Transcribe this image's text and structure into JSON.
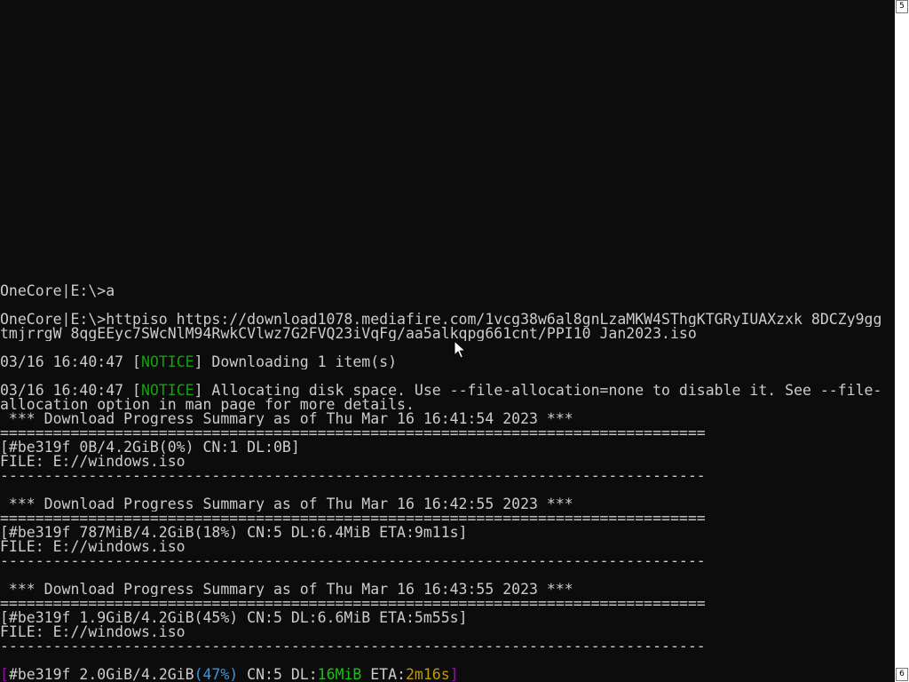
{
  "terminal": {
    "lines": [
      {
        "segments": [
          {
            "t": "OneCore|E:\\>a"
          }
        ]
      },
      {
        "segments": [
          {
            "t": "OneCore|E:\\>httpiso https://download1078.mediafire.com/1vcg38w6al8gnLzaMKW4SThgKTGRyIUAXzxk_8DCZy9gg"
          }
        ]
      },
      {
        "segments": [
          {
            "t": "tmjrrgW_8qgEEyc7SWcNlM94RwkCVlwz7G2FVQ23iVqFg/aa5alkqpg661cnt/PPI10_Jan2023.iso"
          }
        ]
      },
      {
        "segments": [
          {
            "t": "03/16 16:40:47 ["
          },
          {
            "t": "NOTICE",
            "c": "green"
          },
          {
            "t": "] Downloading 1 item(s)"
          }
        ]
      },
      {
        "segments": [
          {
            "t": "03/16 16:40:47 ["
          },
          {
            "t": "NOTICE",
            "c": "green"
          },
          {
            "t": "] Allocating disk space. Use --file-allocation=none to disable it. See --file-"
          }
        ]
      },
      {
        "segments": [
          {
            "t": "allocation option in man page for more details."
          }
        ]
      },
      {
        "segments": [
          {
            "t": " *** Download Progress Summary as of Thu Mar 16 16:41:54 2023 ***"
          }
        ]
      },
      {
        "segments": [
          {
            "t": "================================================================================"
          }
        ]
      },
      {
        "segments": [
          {
            "t": "[#be319f 0B/4.2GiB(0%) CN:1 DL:0B]"
          }
        ]
      },
      {
        "segments": [
          {
            "t": "FILE: E://windows.iso"
          }
        ]
      },
      {
        "segments": [
          {
            "t": "--------------------------------------------------------------------------------"
          }
        ]
      },
      {
        "segments": [
          {
            "t": " *** Download Progress Summary as of Thu Mar 16 16:42:55 2023 ***"
          }
        ]
      },
      {
        "segments": [
          {
            "t": "================================================================================"
          }
        ]
      },
      {
        "segments": [
          {
            "t": "[#be319f 787MiB/4.2GiB(18%) CN:5 DL:6.4MiB ETA:9m11s]"
          }
        ]
      },
      {
        "segments": [
          {
            "t": "FILE: E://windows.iso"
          }
        ]
      },
      {
        "segments": [
          {
            "t": "--------------------------------------------------------------------------------"
          }
        ]
      },
      {
        "segments": [
          {
            "t": " *** Download Progress Summary as of Thu Mar 16 16:43:55 2023 ***"
          }
        ]
      },
      {
        "segments": [
          {
            "t": "================================================================================"
          }
        ]
      },
      {
        "segments": [
          {
            "t": "[#be319f 1.9GiB/4.2GiB(45%) CN:5 DL:6.6MiB ETA:5m55s]"
          }
        ]
      },
      {
        "segments": [
          {
            "t": "FILE: E://windows.iso"
          }
        ]
      },
      {
        "segments": [
          {
            "t": "--------------------------------------------------------------------------------"
          }
        ]
      },
      {
        "segments": [
          {
            "t": "[",
            "c": "purple"
          },
          {
            "t": "#be319f 2.0GiB/4.2GiB"
          },
          {
            "t": "(47%)",
            "c": "cyan"
          },
          {
            "t": " CN:5 DL:"
          },
          {
            "t": "16MiB",
            "c": "lime"
          },
          {
            "t": " ETA:"
          },
          {
            "t": "2m16s",
            "c": "yellow"
          },
          {
            "t": "]",
            "c": "purple"
          }
        ]
      }
    ]
  },
  "scrollbar": {
    "top_number": "5",
    "bottom_number": "6"
  },
  "colors": {
    "background": "#0c0c0c",
    "text": "#cccccc",
    "notice": "#13a10e",
    "bracket": "#881798",
    "percent": "#3a96dd",
    "speed": "#16c60c",
    "eta": "#c19c00"
  }
}
